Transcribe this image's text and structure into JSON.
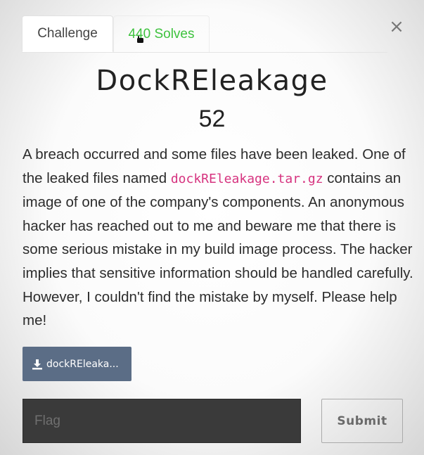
{
  "tabs": [
    {
      "label": "Challenge",
      "active": true
    },
    {
      "label": "440 Solves",
      "active": false,
      "color": "#3ec23e"
    }
  ],
  "close_glyph": "×",
  "challenge": {
    "title": "DockREleakage",
    "points": "52",
    "description": {
      "part1": "A breach occurred and some files have been leaked. One of the leaked files named ",
      "code": "dockREleakage.tar.gz",
      "part2": " contains an image of one of the company's components. An anonymous hacker has reached out to me and beware me that there is some serious mistake in my build image process. The hacker implies that sensitive information should be handled carefully. However, I couldn't find the mistake by myself. Please help me!"
    }
  },
  "file": {
    "label": "dockREleaka...",
    "icon": "download-icon"
  },
  "flag": {
    "placeholder": "Flag",
    "value": ""
  },
  "submit_label": "Submit",
  "colors": {
    "solves": "#3ec23e",
    "code": "#d6337f",
    "file_button": "#5b6d86",
    "flag_input": "#3a3a3a"
  }
}
